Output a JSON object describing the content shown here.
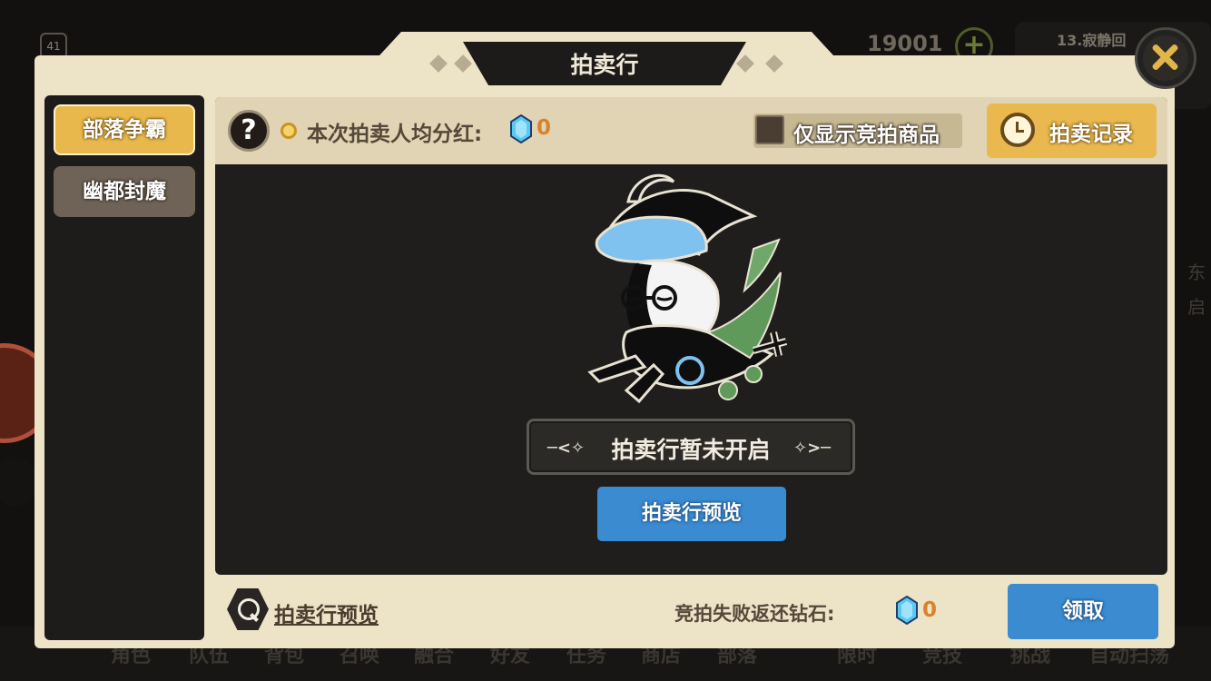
{
  "background": {
    "level": "41",
    "gold": "19001",
    "quest_text": "13.寂静回",
    "side_text_1": "东",
    "side_text_2": "启",
    "nav_items": [
      "角色",
      "队伍",
      "背包",
      "召唤",
      "融合",
      "好友",
      "任务",
      "商店",
      "部落",
      "限时",
      "竞技",
      "挑战",
      "自动扫荡"
    ]
  },
  "dialog": {
    "title": "拍卖行",
    "tabs": [
      {
        "label": "部落争霸",
        "active": true
      },
      {
        "label": "幽都封魔",
        "active": false
      }
    ],
    "info_bar": {
      "help_symbol": "?",
      "bonus_label": "本次拍卖人均分红:",
      "bonus_value": "0",
      "filter_label": "仅显示竞拍商品",
      "filter_checked": false,
      "record_label": "拍卖记录"
    },
    "status_text": "拍卖行暂未开启",
    "preview_button": "拍卖行预览",
    "footer": {
      "preview_link": "拍卖行预览",
      "refund_label": "竞拍失败返还钻石:",
      "refund_value": "0",
      "claim_button": "领取"
    }
  },
  "colors": {
    "panel": "#ede3c7",
    "accent_gold": "#e9b94f",
    "button_blue": "#3b8bd0",
    "diamond_value": "#d9822b"
  },
  "icons": [
    "help-icon",
    "diamond-icon",
    "clock-icon",
    "magnifier-icon",
    "close-icon"
  ]
}
